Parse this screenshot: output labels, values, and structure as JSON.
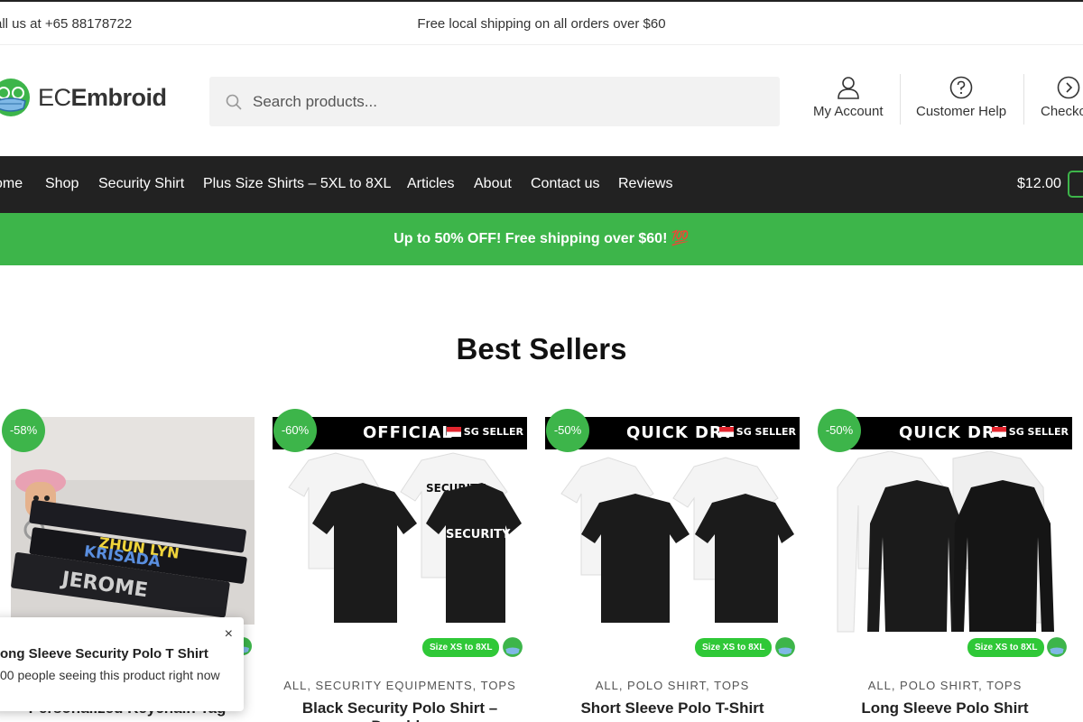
{
  "topbar": {
    "call": "all us at +65 88178722",
    "shipping": "Free local shipping on all orders over $60"
  },
  "header": {
    "logo_light": "EC",
    "logo_bold": "Embroid",
    "search_placeholder": "Search products...",
    "links": [
      {
        "label": "My Account",
        "icon": "user-icon"
      },
      {
        "label": "Customer Help",
        "icon": "help-icon"
      },
      {
        "label": "Checko",
        "icon": "chevron-right-icon"
      }
    ]
  },
  "nav": {
    "items": [
      "ome",
      "Shop",
      "Security Shirt",
      "Plus Size Shirts – 5XL to 8XL",
      "Articles",
      "About",
      "Contact us",
      "Reviews"
    ],
    "cart_total": "$12.00"
  },
  "promo": {
    "text": "Up to 50% OFF! Free shipping over $60! 💯"
  },
  "section_title": "Best Sellers",
  "products": [
    {
      "badge": "-58%",
      "banner": "",
      "sg": "",
      "size": "",
      "cats": "",
      "name": "Personalized Keychain Tag"
    },
    {
      "badge": "-60%",
      "banner": "OFFICIAL",
      "sg": "SG SELLER",
      "size": "Size XS to 8XL",
      "cats": "ALL, SECURITY EQUIPMENTS, TOPS",
      "name": "Black Security Polo Shirt – Durable"
    },
    {
      "badge": "-50%",
      "banner": "QUICK DRY",
      "sg": "SG SELLER",
      "size": "Size XS to 8XL",
      "cats": "ALL, POLO SHIRT, TOPS",
      "name": "Short Sleeve Polo T-Shirt"
    },
    {
      "badge": "-50%",
      "banner": "QUICK DRY",
      "sg": "SG SELLER",
      "size": "Size XS to 8XL",
      "cats": "ALL, POLO SHIRT, TOPS",
      "name": "Long Sleeve Polo Shirt"
    }
  ],
  "keychain_names": [
    "ZHUN LYN",
    "KRISADA",
    "JEROME"
  ],
  "shirt_print": "SECURITY",
  "popup": {
    "title": "ong Sleeve Security Polo T Shirt",
    "subtitle": "00 people seeing this product right now",
    "close": "×"
  },
  "colors": {
    "accent": "#3db54a",
    "nav_bg": "#222222"
  }
}
